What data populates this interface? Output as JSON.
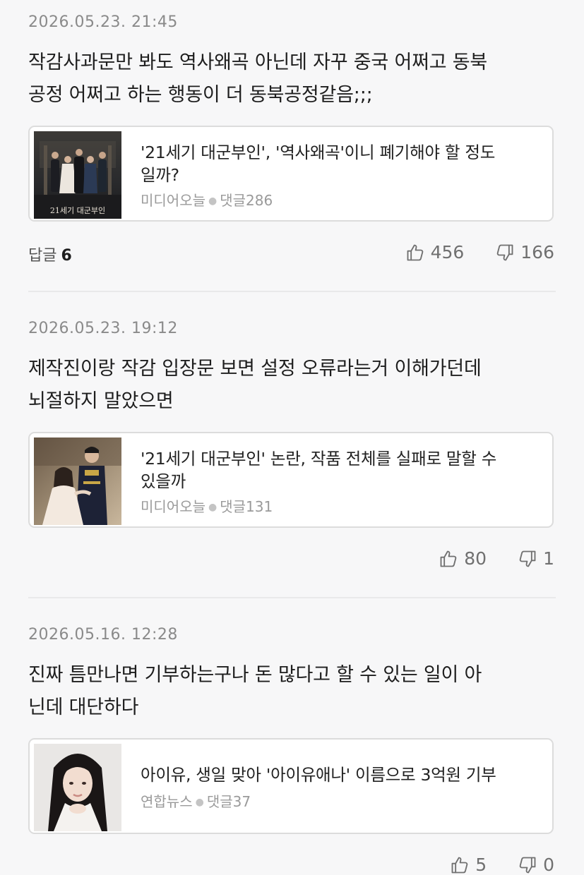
{
  "comments": [
    {
      "date": "2026.05.23. 21:45",
      "lines": [
        "작감사과문만 봐도 역사왜곡 아닌데 자꾸 중국 어쩌고 동북",
        "공정 어쩌고 하는 행동이 더 동북공정같음;;;"
      ],
      "card": {
        "title_lines": [
          "'21세기 대군부인', '역사왜곡'이니 폐기해야 할 정도",
          "일까?"
        ],
        "source": "미디어오늘",
        "comments": "댓글286",
        "thumb_caption": "21세기 대군부인",
        "thumb_icon": "drama-poster-thumbnail-icon"
      },
      "reply_label": "답글",
      "reply_count": "6",
      "likes": "456",
      "dislikes": "166"
    },
    {
      "date": "2026.05.23. 19:12",
      "lines": [
        "제작진이랑 작감 입장문 보면 설정 오류라는거 이해가던데",
        "뇌절하지 말았으면"
      ],
      "card": {
        "title_lines": [
          "'21세기 대군부인' 논란, 작품 전체를 실패로 말할 수",
          "있을까"
        ],
        "source": "미디어오늘",
        "comments": "댓글131",
        "thumb_icon": "drama-couple-thumbnail-icon"
      },
      "likes": "80",
      "dislikes": "1"
    },
    {
      "date": "2026.05.16. 12:28",
      "lines": [
        "진짜 틈만나면 기부하는구나 돈 많다고 할 수 있는 일이 아",
        "닌데 대단하다"
      ],
      "card": {
        "title_lines": [
          "아이유, 생일 맞아 '아이유애나' 이름으로 3억원 기부"
        ],
        "source": "연합뉴스",
        "comments": "댓글37",
        "thumb_icon": "portrait-thumbnail-icon"
      },
      "likes": "5",
      "dislikes": "0"
    }
  ],
  "colors": {
    "background": "#f7f7f8",
    "card_border": "#dcdcdc",
    "meta_text": "#9a9a9a",
    "divider": "#e9e9ea"
  }
}
